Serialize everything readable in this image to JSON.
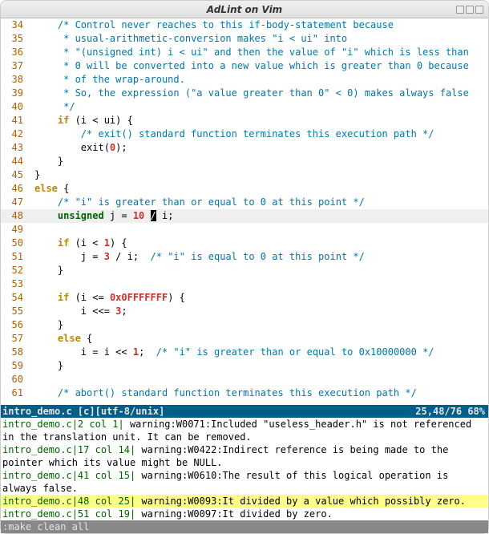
{
  "window": {
    "title": "AdLint on Vim"
  },
  "code": {
    "first_lineno": 34,
    "highlight_lineno": 48,
    "lines": [
      {
        "n": 34,
        "seg": [
          [
            "    ",
            ""
          ],
          [
            "/* Control never reaches to this if-body-statement because",
            "cm"
          ]
        ]
      },
      {
        "n": 35,
        "seg": [
          [
            "     ",
            ""
          ],
          [
            "* usual-arithmetic-conversion makes \"i < ui\" into",
            "cm"
          ]
        ]
      },
      {
        "n": 36,
        "seg": [
          [
            "     ",
            ""
          ],
          [
            "* \"(unsigned int) i < ui\" and then the value of \"i\" which is less than",
            "cm"
          ]
        ]
      },
      {
        "n": 37,
        "seg": [
          [
            "     ",
            ""
          ],
          [
            "* 0 will be converted into a new value which is greater than 0 because",
            "cm"
          ]
        ]
      },
      {
        "n": 38,
        "seg": [
          [
            "     ",
            ""
          ],
          [
            "* of the wrap-around.",
            "cm"
          ]
        ]
      },
      {
        "n": 39,
        "seg": [
          [
            "     ",
            ""
          ],
          [
            "* So, the expression (\"a value greater than 0\" < 0) makes always false",
            "cm"
          ]
        ]
      },
      {
        "n": 40,
        "seg": [
          [
            "     ",
            ""
          ],
          [
            "*/",
            "cm"
          ]
        ]
      },
      {
        "n": 41,
        "seg": [
          [
            "    ",
            ""
          ],
          [
            "if",
            "kw"
          ],
          [
            " (i < ui) {",
            ""
          ]
        ]
      },
      {
        "n": 42,
        "seg": [
          [
            "        ",
            ""
          ],
          [
            "/* exit() standard function terminates this execution path */",
            "cm"
          ]
        ]
      },
      {
        "n": 43,
        "seg": [
          [
            "        ",
            ""
          ],
          [
            "exit(",
            ""
          ],
          [
            "0",
            "nm"
          ],
          [
            ");",
            ""
          ]
        ]
      },
      {
        "n": 44,
        "seg": [
          [
            "    }",
            ""
          ]
        ]
      },
      {
        "n": 45,
        "seg": [
          [
            "}",
            ""
          ]
        ]
      },
      {
        "n": 46,
        "seg": [
          [
            "",
            ""
          ],
          [
            "else",
            "kw"
          ],
          [
            " {",
            ""
          ]
        ]
      },
      {
        "n": 47,
        "seg": [
          [
            "    ",
            ""
          ],
          [
            "/* \"i\" is greater than or equal to 0 at this point */",
            "cm"
          ]
        ]
      },
      {
        "n": 48,
        "seg": [
          [
            "    ",
            ""
          ],
          [
            "unsigned",
            "ty"
          ],
          [
            " j = ",
            ""
          ],
          [
            "10",
            "nm"
          ],
          [
            " ",
            ""
          ],
          [
            "/",
            "cursor"
          ],
          [
            " i;",
            ""
          ]
        ]
      },
      {
        "n": 49,
        "seg": [
          [
            "",
            ""
          ]
        ]
      },
      {
        "n": 50,
        "seg": [
          [
            "    ",
            ""
          ],
          [
            "if",
            "kw"
          ],
          [
            " (i < ",
            ""
          ],
          [
            "1",
            "nm"
          ],
          [
            ") {",
            ""
          ]
        ]
      },
      {
        "n": 51,
        "seg": [
          [
            "        j = ",
            ""
          ],
          [
            "3",
            "nm"
          ],
          [
            " / i;  ",
            ""
          ],
          [
            "/* \"i\" is equal to 0 at this point */",
            "cm"
          ]
        ]
      },
      {
        "n": 52,
        "seg": [
          [
            "    }",
            ""
          ]
        ]
      },
      {
        "n": 53,
        "seg": [
          [
            "",
            ""
          ]
        ]
      },
      {
        "n": 54,
        "seg": [
          [
            "    ",
            ""
          ],
          [
            "if",
            "kw"
          ],
          [
            " (i <= ",
            ""
          ],
          [
            "0x0FFFFFFF",
            "nm"
          ],
          [
            ") {",
            ""
          ]
        ]
      },
      {
        "n": 55,
        "seg": [
          [
            "        i <<= ",
            ""
          ],
          [
            "3",
            "nm"
          ],
          [
            ";",
            ""
          ]
        ]
      },
      {
        "n": 56,
        "seg": [
          [
            "    }",
            ""
          ]
        ]
      },
      {
        "n": 57,
        "seg": [
          [
            "    ",
            ""
          ],
          [
            "else",
            "kw"
          ],
          [
            " {",
            ""
          ]
        ]
      },
      {
        "n": 58,
        "seg": [
          [
            "        i = i << ",
            ""
          ],
          [
            "1",
            "nm"
          ],
          [
            ";  ",
            ""
          ],
          [
            "/* \"i\" is greater than or equal to 0x10000000 */",
            "cm"
          ]
        ]
      },
      {
        "n": 59,
        "seg": [
          [
            "    }",
            ""
          ]
        ]
      },
      {
        "n": 60,
        "seg": [
          [
            "",
            ""
          ]
        ]
      },
      {
        "n": 61,
        "seg": [
          [
            "    ",
            ""
          ],
          [
            "/* abort() standard function terminates this execution path */",
            "cm"
          ]
        ]
      }
    ]
  },
  "statusline": {
    "left": "intro_demo.c [c][utf-8/unix]",
    "right": "25,48/76        68%"
  },
  "quickfix": [
    {
      "loc": "intro_demo.c|2 col 1|",
      "msg": " warning:W0071:Included \"useless_header.h\" is not referenced in the translation unit. It can be removed.",
      "sel": false
    },
    {
      "loc": "intro_demo.c|17 col 14|",
      "msg": " warning:W0422:Indirect reference is being made to the pointer which its value might be NULL.",
      "sel": false
    },
    {
      "loc": "intro_demo.c|41 col 15|",
      "msg": " warning:W0610:The result of this logical operation is always false.",
      "sel": false
    },
    {
      "loc": "intro_demo.c|48 col 25|",
      "msg": " warning:W0093:It divided by a value which possibly zero.",
      "sel": true
    },
    {
      "loc": "intro_demo.c|51 col 19|",
      "msg": " warning:W0097:It divided by zero.",
      "sel": false
    }
  ],
  "cmdline": ":make clean all"
}
